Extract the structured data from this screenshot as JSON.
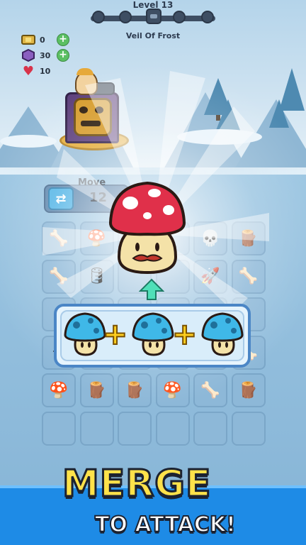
{
  "hud": {
    "level": "Level 13",
    "stage_name": "Veil Of Frost",
    "resources": [
      {
        "icon": "ticket-icon",
        "value": "0"
      },
      {
        "icon": "gem-icon",
        "value": "30"
      },
      {
        "icon": "heart-icon",
        "value": "10"
      }
    ]
  },
  "board": {
    "move_label": "Move",
    "move_count": "12",
    "cells": [
      {
        "r": 0,
        "c": 0,
        "icon": "bone-icon",
        "glyph": "🦴"
      },
      {
        "r": 0,
        "c": 1,
        "icon": "blue-mushroom-icon",
        "glyph": "🍄"
      },
      {
        "r": 0,
        "c": 4,
        "icon": "skeleton-icon",
        "glyph": "💀"
      },
      {
        "r": 0,
        "c": 5,
        "icon": "wood-log-icon",
        "glyph": "🪵"
      },
      {
        "r": 1,
        "c": 0,
        "icon": "bone-icon",
        "glyph": "🦴"
      },
      {
        "r": 1,
        "c": 1,
        "icon": "barrel-icon",
        "glyph": "🛢"
      },
      {
        "r": 1,
        "c": 4,
        "icon": "rocket-icon",
        "glyph": "🚀"
      },
      {
        "r": 1,
        "c": 5,
        "icon": "bone-icon",
        "glyph": "🦴"
      },
      {
        "r": 3,
        "c": 0,
        "icon": "green-rune-icon",
        "glyph": "❖"
      },
      {
        "r": 3,
        "c": 1,
        "icon": "skeleton-icon",
        "glyph": "💀"
      },
      {
        "r": 3,
        "c": 2,
        "icon": "bone-icon",
        "glyph": "🦴"
      },
      {
        "r": 3,
        "c": 3,
        "icon": "bone-icon",
        "glyph": "🦴"
      },
      {
        "r": 3,
        "c": 4,
        "icon": "dynamite-icon",
        "glyph": "🧨"
      },
      {
        "r": 3,
        "c": 5,
        "icon": "bone-icon",
        "glyph": "🦴"
      },
      {
        "r": 4,
        "c": 0,
        "icon": "brown-mushroom-icon",
        "glyph": "🍄"
      },
      {
        "r": 4,
        "c": 1,
        "icon": "wood-log-icon",
        "glyph": "🪵"
      },
      {
        "r": 4,
        "c": 2,
        "icon": "wood-log-icon",
        "glyph": "🪵"
      },
      {
        "r": 4,
        "c": 3,
        "icon": "brown-mushroom-icon",
        "glyph": "🍄"
      },
      {
        "r": 4,
        "c": 4,
        "icon": "bone-icon",
        "glyph": "🦴"
      },
      {
        "r": 4,
        "c": 5,
        "icon": "wood-log-icon",
        "glyph": "🪵"
      }
    ]
  },
  "banner": {
    "line1": "MERGE",
    "line2": "TO ATTACK!"
  }
}
